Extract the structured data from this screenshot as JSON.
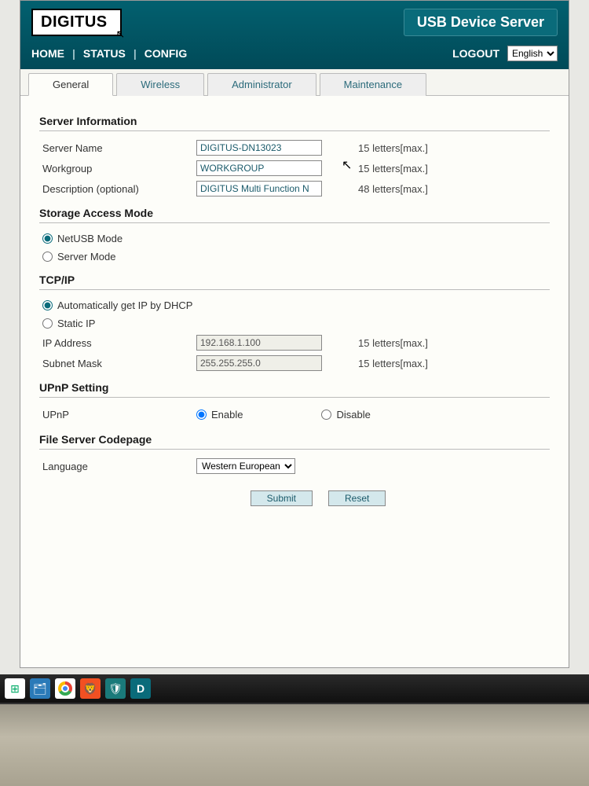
{
  "header": {
    "logo_text": "DIGITUS",
    "product_title": "USB Device Server"
  },
  "nav": {
    "home": "HOME",
    "status": "STATUS",
    "config": "CONFIG",
    "logout": "LOGOUT",
    "lang_selected": "English"
  },
  "tabs": {
    "general": "General",
    "wireless": "Wireless",
    "administrator": "Administrator",
    "maintenance": "Maintenance"
  },
  "sections": {
    "server_info": "Server Information",
    "storage_mode": "Storage Access Mode",
    "tcpip": "TCP/IP",
    "upnp": "UPnP Setting",
    "codepage": "File Server Codepage"
  },
  "fields": {
    "server_name_label": "Server Name",
    "server_name_value": "DIGITUS-DN13023",
    "server_name_hint": "15 letters[max.]",
    "workgroup_label": "Workgroup",
    "workgroup_value": "WORKGROUP",
    "workgroup_hint": "15 letters[max.]",
    "description_label": "Description (optional)",
    "description_value": "DIGITUS Multi Function N",
    "description_hint": "48 letters[max.]",
    "netusb_label": "NetUSB Mode",
    "server_mode_label": "Server Mode",
    "dhcp_label": "Automatically get IP by DHCP",
    "static_label": "Static IP",
    "ip_label": "IP Address",
    "ip_value": "192.168.1.100",
    "ip_hint": "15 letters[max.]",
    "subnet_label": "Subnet Mask",
    "subnet_value": "255.255.255.0",
    "subnet_hint": "15 letters[max.]",
    "upnp_label": "UPnP",
    "upnp_enable": "Enable",
    "upnp_disable": "Disable",
    "language_label": "Language",
    "codepage_selected": "Western European"
  },
  "buttons": {
    "submit": "Submit",
    "reset": "Reset"
  }
}
